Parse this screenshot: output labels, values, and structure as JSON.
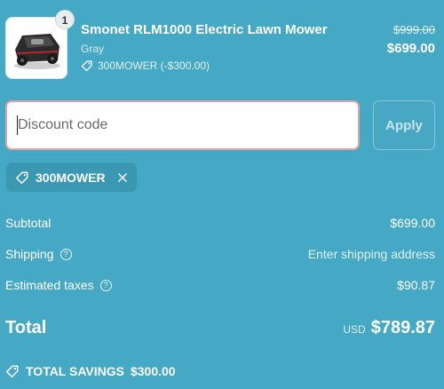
{
  "product": {
    "image": "lawn-mower-image",
    "quantity": "1",
    "name": "Smonet RLM1000 Electric Lawn Mower",
    "variant": "Gray",
    "discount_label": "300MOWER (-$300.00)",
    "compare_price": "$999.00",
    "price": "$699.00"
  },
  "discount": {
    "placeholder": "Discount code",
    "value": "",
    "apply_label": "Apply",
    "applied_code": "300MOWER"
  },
  "summary": {
    "subtotal_label": "Subtotal",
    "subtotal_value": "$699.00",
    "shipping_label": "Shipping",
    "shipping_value": "Enter shipping address",
    "taxes_label": "Estimated taxes",
    "taxes_value": "$90.87",
    "total_label": "Total",
    "currency": "USD",
    "total_value": "$789.87",
    "savings_label": "TOTAL SAVINGS",
    "savings_value": "$300.00"
  },
  "colors": {
    "background": "#45a8c4",
    "input_border": "#e5a0a0",
    "text": "#ffffff"
  }
}
